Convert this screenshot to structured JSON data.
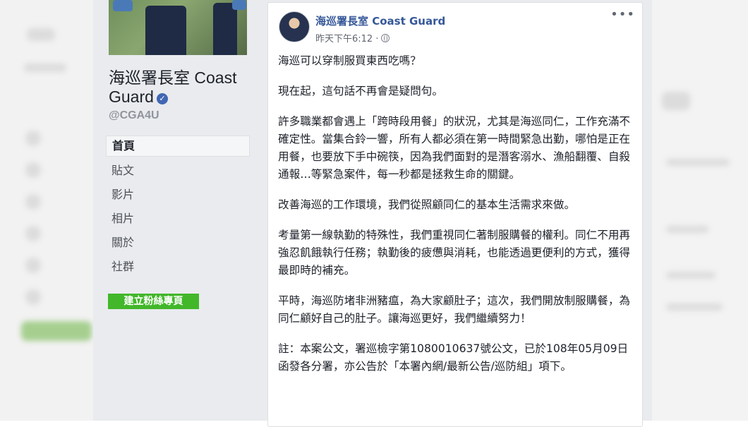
{
  "sidebar": {
    "page_name": "海巡署長室 Coast Guard",
    "handle": "@CGA4U",
    "nav_items": [
      {
        "label": "首頁",
        "active": true
      },
      {
        "label": "貼文",
        "active": false
      },
      {
        "label": "影片",
        "active": false
      },
      {
        "label": "相片",
        "active": false
      },
      {
        "label": "關於",
        "active": false
      },
      {
        "label": "社群",
        "active": false
      }
    ],
    "create_page_label": "建立粉絲專頁",
    "verified_icon": "check-badge-icon"
  },
  "post": {
    "author": "海巡署長室 Coast Guard",
    "time": "昨天下午6:12 ·",
    "privacy_icon": "globe-icon",
    "more_icon": "more-options-icon",
    "paragraphs": [
      "海巡可以穿制服買東西吃嗎？",
      "現在起，這句話不再會是疑問句。",
      "許多職業都會遇上「跨時段用餐」的狀況，尤其是海巡同仁，工作充滿不確定性。當集合鈴一響，所有人都必須在第一時間緊急出勤，哪怕是正在用餐，也要放下手中碗筷，因為我們面對的是潛客溺水、漁船翻覆、自殺通報…等緊急案件，每一秒都是拯救生命的關鍵。",
      "改善海巡的工作環境，我們從照顧同仁的基本生活需求來做。",
      "考量第一線執勤的特殊性，我們重視同仁著制服購餐的權利。同仁不用再強忍飢餓執行任務；執勤後的疲憊與消耗，也能透過更便利的方式，獲得最即時的補充。",
      "平時，海巡防堵非洲豬瘟，為大家顧肚子；這次，我們開放制服購餐，為同仁顧好自己的肚子。讓海巡更好，我們繼續努力！",
      "註：本案公文，署巡檢字第1080010637號公文，已於108年05月09日函發各分署，亦公告於「本署內網/最新公告/巡防組」項下。"
    ]
  },
  "colors": {
    "link_blue": "#365899",
    "create_green": "#42b72a",
    "verified_blue": "#4267b2",
    "background": "#e9ebee"
  }
}
